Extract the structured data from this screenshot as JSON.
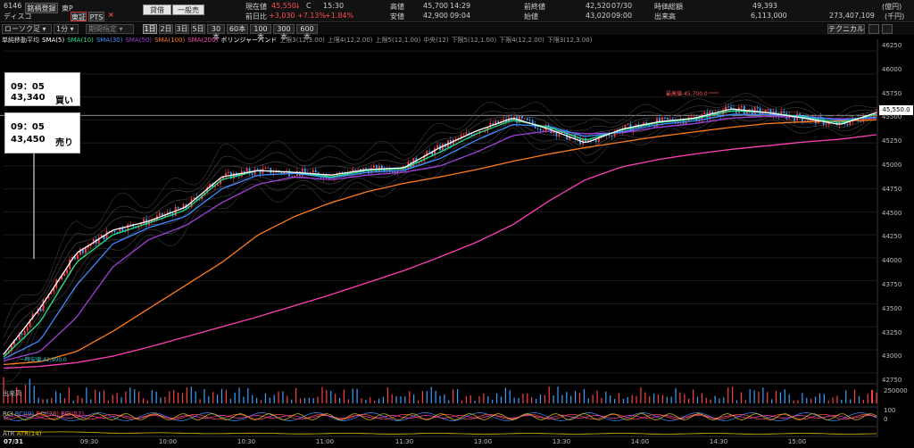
{
  "header": {
    "code": "6146",
    "name": "ディスコ",
    "market_short": "東P",
    "register_label": "銘柄登録",
    "tab_tosho": "東証",
    "tab_pts": "PTS",
    "x_label": "×",
    "btn_credit": "貸借",
    "btn_general": "一般売",
    "cur_label": "現在値",
    "cur_value": "45,550",
    "cur_arrow": "↓",
    "cur_flag": "C",
    "cur_time": "15:30",
    "prev_label": "前日比",
    "prev_value": "+3,030",
    "prev_pct": "+7.13%",
    "prev_pct2": "+1.84%",
    "high_label": "高値",
    "high_value": "45,700",
    "high_time": "14:29",
    "low_label": "安値",
    "low_value": "42,900",
    "low_time": "09:04",
    "prevclose_label": "前終値",
    "prevclose_value": "42,520",
    "prevclose_date": "07/30",
    "open_label": "始値",
    "open_value": "43,020",
    "open_time": "09:00",
    "mcap_label": "時価総額",
    "mcap_value": "49,393",
    "mcap_unit": "(億円)",
    "vol_label": "出来高",
    "vol_value": "6,113,000",
    "amt_value": "273,407,109",
    "amt_unit": "(千円)"
  },
  "toolbar": {
    "chart_type": "ローソク足",
    "interval": "1分",
    "period": "期間指定",
    "tabs": [
      "1日",
      "2日",
      "3日",
      "5日",
      "30本",
      "60本",
      "100本",
      "300本",
      "600本"
    ],
    "technical_btn": "テクニカル"
  },
  "legend": [
    {
      "text": "単純移動平均",
      "color": "#d9d9d9"
    },
    {
      "text": "SMA(5)",
      "color": "#ffffff"
    },
    {
      "text": "SMA(10)",
      "color": "#22e08a"
    },
    {
      "text": "SMA(30)",
      "color": "#3d8bff"
    },
    {
      "text": "SMA(50)",
      "color": "#a040d8"
    },
    {
      "text": "SMA(100)",
      "color": "#ff7a1a"
    },
    {
      "text": "SMA(200)",
      "color": "#ff3fb4"
    },
    {
      "text": "ボリンジャーバンド",
      "color": "#ffffff"
    },
    {
      "text": "上限3(12,3.00)",
      "color": "#9a9a9a"
    },
    {
      "text": "上限4(12,2.00)",
      "color": "#9a9a9a"
    },
    {
      "text": "上限5(12,1.00)",
      "color": "#9a9a9a"
    },
    {
      "text": "中央(12)",
      "color": "#9a9a9a"
    },
    {
      "text": "下限5(12,1.00)",
      "color": "#9a9a9a"
    },
    {
      "text": "下限4(12,2.00)",
      "color": "#9a9a9a"
    },
    {
      "text": "下限3(12,3.00)",
      "color": "#9a9a9a"
    }
  ],
  "callouts": {
    "buy_time": "09：05",
    "buy_price": "43,340",
    "buy_side": "買い",
    "sell_time": "09：05",
    "sell_price": "43,450",
    "sell_side": "売り"
  },
  "chart_labels": {
    "high_marker": "最高値:45,700.0",
    "low_marker": "一時安値:42,900.0",
    "current_price": "45,550.0"
  },
  "y_axis": [
    "46250",
    "46000",
    "45750",
    "45500",
    "45250",
    "45000",
    "44750",
    "44500",
    "44250",
    "44000",
    "43750",
    "43500",
    "43250",
    "43000",
    "42750"
  ],
  "x_axis": {
    "date": "07/31",
    "times": [
      "09:30",
      "10:00",
      "10:30",
      "11:00",
      "11:30",
      "13:00",
      "13:30",
      "14:00",
      "14:30",
      "15:00"
    ]
  },
  "volume_panel": {
    "title": "出来高",
    "axis": "250000"
  },
  "rci_panel": {
    "title": "RCI",
    "series": [
      "RCI(9)",
      "RCI(26)",
      "RCI(52)"
    ],
    "axis_top": "100",
    "axis_mid": "0"
  },
  "atr_panel": {
    "title": "ATR",
    "series": "ATR(14)"
  },
  "chart_data": {
    "type": "line",
    "x": [
      "09:00",
      "09:05",
      "09:15",
      "09:30",
      "09:45",
      "10:00",
      "10:15",
      "10:30",
      "10:45",
      "11:00",
      "11:15",
      "11:30",
      "12:30",
      "12:45",
      "13:00",
      "13:15",
      "13:30",
      "13:45",
      "14:00",
      "14:15",
      "14:30",
      "14:45",
      "15:00",
      "15:15",
      "15:30"
    ],
    "series": [
      {
        "name": "SMA(5)",
        "color": "#ffffff",
        "values": [
          42950,
          43450,
          44050,
          44300,
          44400,
          44550,
          44880,
          44950,
          44930,
          44900,
          44960,
          44980,
          45200,
          45380,
          45520,
          45400,
          45250,
          45400,
          45480,
          45520,
          45620,
          45580,
          45520,
          45450,
          45580
        ]
      },
      {
        "name": "SMA(10)",
        "color": "#22e08a",
        "values": [
          42920,
          43300,
          43950,
          44250,
          44380,
          44520,
          44850,
          44950,
          44930,
          44880,
          44950,
          44970,
          45150,
          45350,
          45500,
          45420,
          45280,
          45390,
          45470,
          45510,
          45600,
          45580,
          45530,
          45470,
          45560
        ]
      },
      {
        "name": "SMA(30)",
        "color": "#3d8bff",
        "values": [
          42900,
          43100,
          43700,
          44150,
          44330,
          44450,
          44750,
          44900,
          44920,
          44870,
          44930,
          44950,
          45080,
          45280,
          45450,
          45430,
          45320,
          45370,
          45450,
          45490,
          45560,
          45560,
          45540,
          45500,
          45530
        ]
      },
      {
        "name": "SMA(50)",
        "color": "#a040d8",
        "values": [
          42880,
          42980,
          43350,
          43900,
          44200,
          44350,
          44600,
          44800,
          44880,
          44850,
          44900,
          44930,
          45000,
          45150,
          45330,
          45380,
          45350,
          45360,
          45420,
          45460,
          45520,
          45540,
          45530,
          45510,
          45520
        ]
      },
      {
        "name": "SMA(100)",
        "color": "#ff7a1a",
        "values": [
          42840,
          42870,
          42980,
          43200,
          43450,
          43700,
          43950,
          44250,
          44450,
          44600,
          44720,
          44810,
          44880,
          44960,
          45050,
          45130,
          45200,
          45260,
          45320,
          45370,
          45420,
          45460,
          45480,
          45490,
          45500
        ]
      },
      {
        "name": "SMA(200)",
        "color": "#ff3fb4",
        "values": [
          42800,
          42820,
          42860,
          42930,
          43030,
          43140,
          43250,
          43360,
          43480,
          43600,
          43730,
          43860,
          44010,
          44170,
          44360,
          44620,
          44850,
          44990,
          45070,
          45130,
          45180,
          45220,
          45260,
          45290,
          45340
        ]
      }
    ],
    "ylim": [
      42650,
      46300
    ],
    "markers": {
      "high": 45700,
      "low": 42900,
      "current": 45550
    }
  }
}
